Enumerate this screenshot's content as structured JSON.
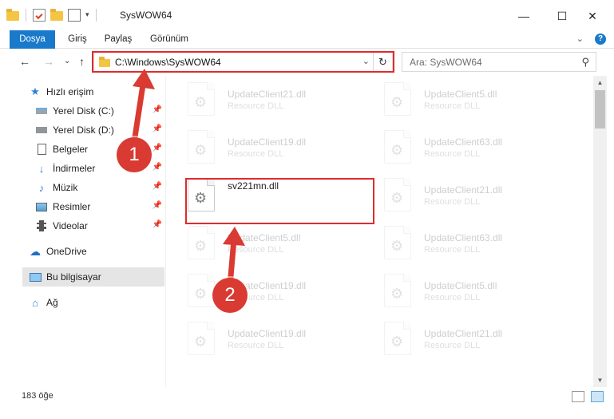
{
  "window": {
    "title": "SysWOW64",
    "minimize_glyph": "—",
    "maximize_glyph": "☐",
    "close_glyph": "✕"
  },
  "ribbon": {
    "tabs": [
      {
        "label": "Dosya"
      },
      {
        "label": "Giriş"
      },
      {
        "label": "Paylaş"
      },
      {
        "label": "Görünüm"
      }
    ],
    "expand_glyph": "⌄",
    "help_glyph": "?"
  },
  "nav": {
    "back_glyph": "←",
    "forward_glyph": "→",
    "recent_glyph": "⌄",
    "up_glyph": "↑",
    "address": "C:\\Windows\\SysWOW64",
    "address_dropdown_glyph": "⌄",
    "refresh_glyph": "↻",
    "search_placeholder": "Ara: SysWOW64",
    "search_glyph": "⚲"
  },
  "sidebar": {
    "items": [
      {
        "label": "Hızlı erişim",
        "icon": "star-icon",
        "pinned": false
      },
      {
        "label": "Yerel Disk (C:)",
        "icon": "drive-icon",
        "pinned": true
      },
      {
        "label": "Yerel Disk (D:)",
        "icon": "drive-icon",
        "pinned": true
      },
      {
        "label": "Belgeler",
        "icon": "document-icon",
        "pinned": true
      },
      {
        "label": "İndirmeler",
        "icon": "download-icon",
        "pinned": true
      },
      {
        "label": "Müzik",
        "icon": "music-icon",
        "pinned": true
      },
      {
        "label": "Resimler",
        "icon": "picture-icon",
        "pinned": true
      },
      {
        "label": "Videolar",
        "icon": "video-icon",
        "pinned": true
      },
      {
        "label": "OneDrive",
        "icon": "cloud-icon",
        "pinned": false
      },
      {
        "label": "Bu bilgisayar",
        "icon": "computer-icon",
        "pinned": false
      },
      {
        "label": "Ağ",
        "icon": "network-icon",
        "pinned": false
      }
    ],
    "pin_glyph": "📌"
  },
  "files": {
    "left_column": [
      {
        "name": "UpdateClient21.dll",
        "type": "Resource DLL",
        "faded": true
      },
      {
        "name": "UpdateClient19.dll",
        "type": "Resource DLL",
        "faded": true
      },
      {
        "name": "sv221mn.dll",
        "type": "",
        "faded": false
      },
      {
        "name": "UpdateClient5.dll",
        "type": "Resource DLL",
        "faded": true
      },
      {
        "name": "UpdateClient19.dll",
        "type": "Resource DLL",
        "faded": true
      },
      {
        "name": "UpdateClient19.dll",
        "type": "Resource DLL",
        "faded": true
      }
    ],
    "right_column": [
      {
        "name": "UpdateClient5.dll",
        "type": "Resource DLL",
        "faded": true
      },
      {
        "name": "UpdateClient63.dll",
        "type": "Resource DLL",
        "faded": true
      },
      {
        "name": "UpdateClient21.dll",
        "type": "Resource DLL",
        "faded": true
      },
      {
        "name": "UpdateClient63.dll",
        "type": "Resource DLL",
        "faded": true
      },
      {
        "name": "UpdateClient5.dll",
        "type": "Resource DLL",
        "faded": true
      },
      {
        "name": "UpdateClient21.dll",
        "type": "Resource DLL",
        "faded": true
      }
    ]
  },
  "status": {
    "item_count": "183 öğe"
  },
  "annotations": {
    "step1": "1",
    "step2": "2",
    "color": "#d93a32"
  },
  "colors": {
    "accent": "#1979ca",
    "highlight": "#e02b2b"
  }
}
